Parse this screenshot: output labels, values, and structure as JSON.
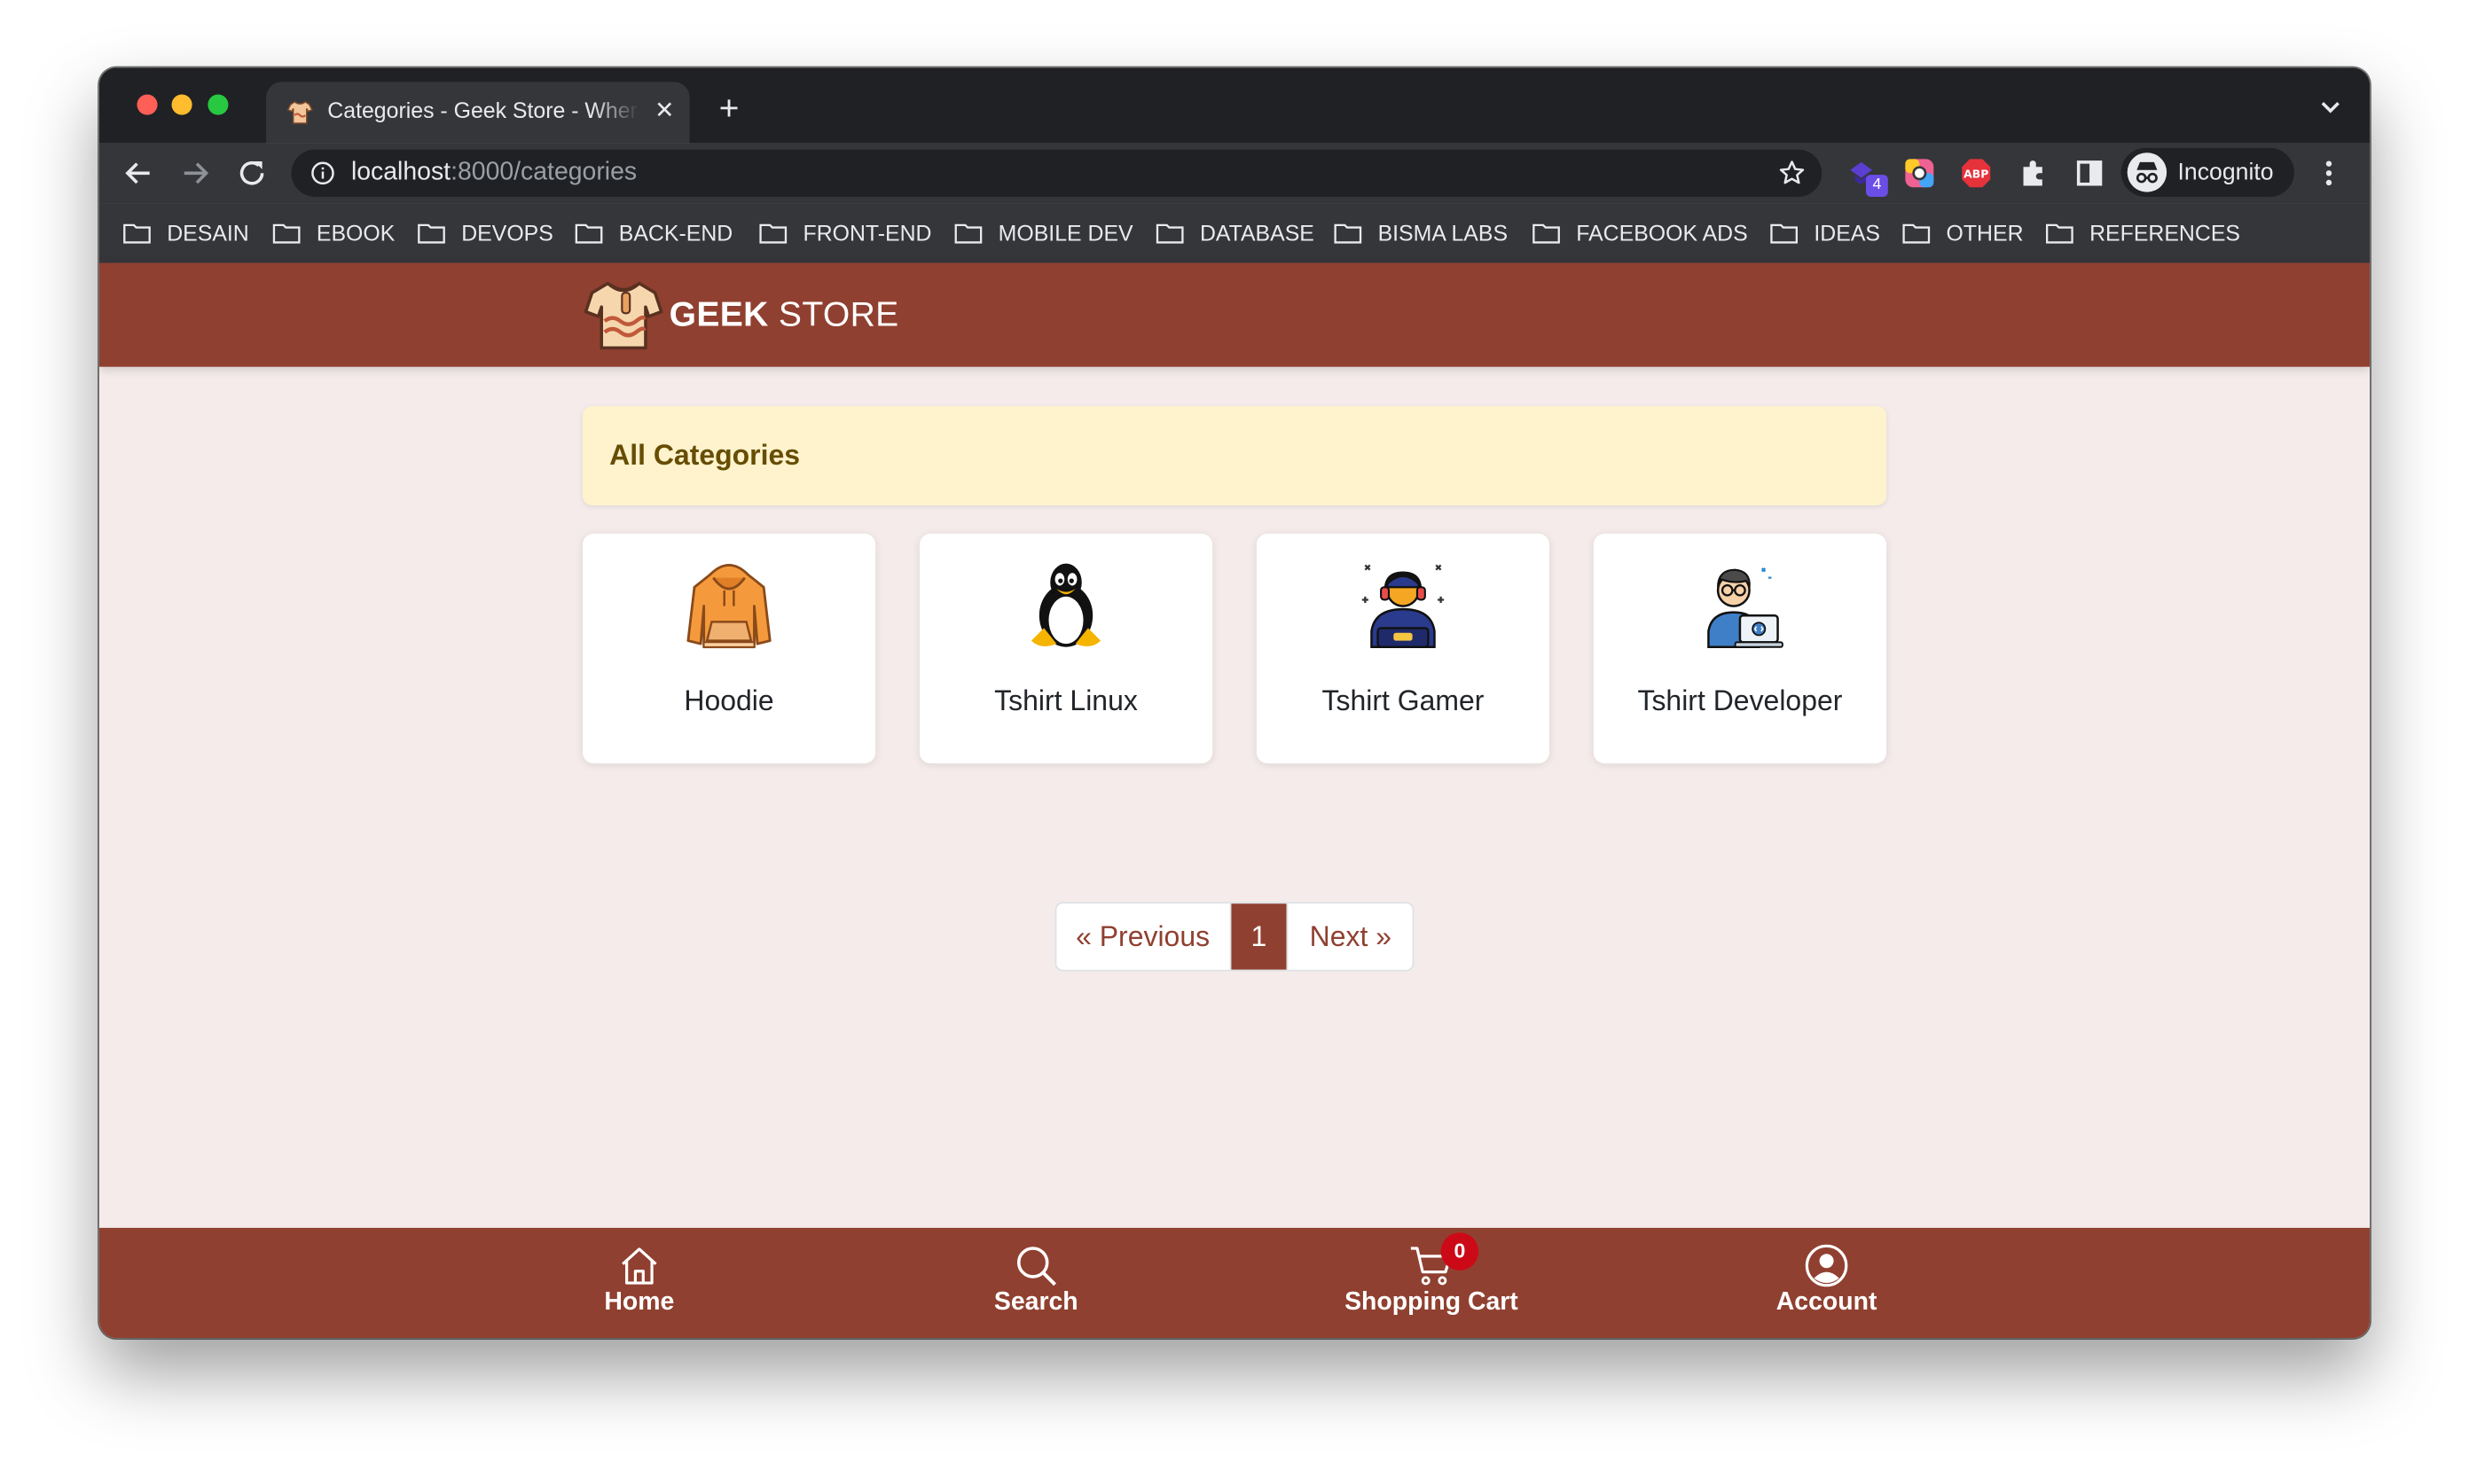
{
  "browser": {
    "tab_title": "Categories - Geek Store - Where Geeks Shop",
    "tab_close": "✕",
    "new_tab": "+",
    "url_host": "localhost",
    "url_path": ":8000/categories",
    "extension_badge": "4",
    "profile_label": "Incognito",
    "bookmarks": [
      "DESAIN",
      "EBOOK",
      "DEVOPS",
      "BACK-END",
      "FRONT-END",
      "MOBILE DEV",
      "DATABASE",
      "BISMA LABS",
      "FACEBOOK ADS",
      "IDEAS",
      "OTHER",
      "REFERENCES"
    ]
  },
  "site": {
    "brand_bold": "GEEK",
    "brand_light": " STORE",
    "section_title": "All Categories",
    "categories": [
      {
        "name": "Hoodie",
        "icon": "hoodie-icon"
      },
      {
        "name": "Tshirt Linux",
        "icon": "tux-penguin-icon"
      },
      {
        "name": "Tshirt Gamer",
        "icon": "gamer-icon"
      },
      {
        "name": "Tshirt Developer",
        "icon": "developer-icon"
      }
    ],
    "pagination": {
      "previous": "« Previous",
      "current": "1",
      "next": "Next »"
    },
    "bottom_nav": {
      "home": "Home",
      "search": "Search",
      "cart": "Shopping Cart",
      "cart_count": "0",
      "account": "Account"
    }
  },
  "colors": {
    "brand": "#904030",
    "page_background": "#f4ebea",
    "alert_background": "#fff3cd",
    "alert_text": "#664d03",
    "badge": "#cc0a17"
  }
}
